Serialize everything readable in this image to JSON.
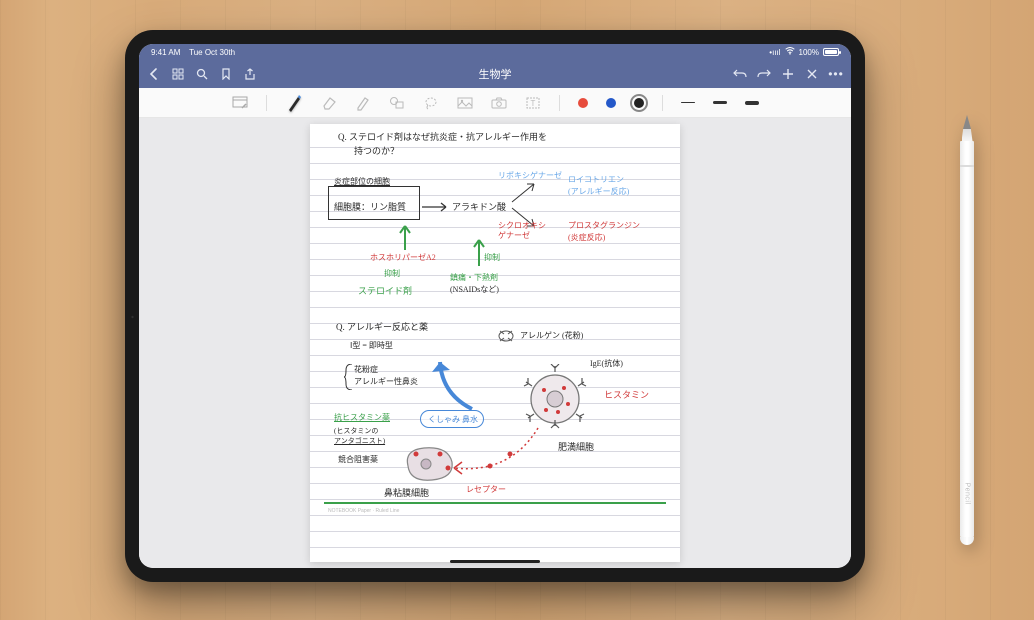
{
  "status": {
    "time": "9:41 AM",
    "date": "Tue Oct 30th",
    "signal": "•ıııl",
    "wifi": "⌔",
    "battery_pct": "100%"
  },
  "nav": {
    "title": "生物学"
  },
  "tools": {
    "readonly": "readonly",
    "pen": "pen",
    "eraser": "eraser",
    "highlighter": "highlighter",
    "shape": "shape",
    "lasso": "lasso",
    "image": "image",
    "camera": "camera",
    "text": "text"
  },
  "colors": {
    "red": "#e74c3c",
    "blue": "#2458c9",
    "black": "#222222"
  },
  "notes": {
    "q1_line1": "Q. ステロイド剤はなぜ抗炎症・抗アレルギー作用を",
    "q1_line2": "持つのか？",
    "box_top": "炎症部位の細胞",
    "box_main": "細胞膜：リン脂質",
    "arachidonic": "アラキドン酸",
    "lipoxygenase": "リポキシゲナーゼ",
    "leukotriene1": "ロイコトリエン",
    "leukotriene2": "(アレルギー反応)",
    "cyclooxygenase1": "シクロオキシ",
    "cyclooxygenase2": "ゲナーゼ",
    "prostaglandin1": "プロスタグランジン",
    "prostaglandin2": "(炎症反応)",
    "phospholipase": "ホスホリパーゼA2",
    "inhibit1": "抑制",
    "inhibit2": "抑制",
    "steroid": "ステロイド剤",
    "nsaids1": "鎮痛・下熱剤",
    "nsaids2": "(NSAIDsなど)",
    "q2": "Q. アレルギー反応と薬",
    "type1": "Ⅰ型 = 即時型",
    "ex1": "花粉症",
    "ex2": "アレルギー性鼻炎",
    "antihistamine": "抗ヒスタミン薬",
    "antagonist1": "(ヒスタミンの",
    "antagonist2": "アンタゴニスト)",
    "compete": "競合阻害薬",
    "mucosal": "鼻粘膜細胞",
    "sneeze": "くしゃみ 鼻水",
    "receptor": "レセプター",
    "allergen": "アレルゲン (花粉)",
    "ige": "IgE(抗体)",
    "histamine": "ヒスタミン",
    "mastcell": "肥満細胞"
  },
  "pencil_label": " Pencil"
}
